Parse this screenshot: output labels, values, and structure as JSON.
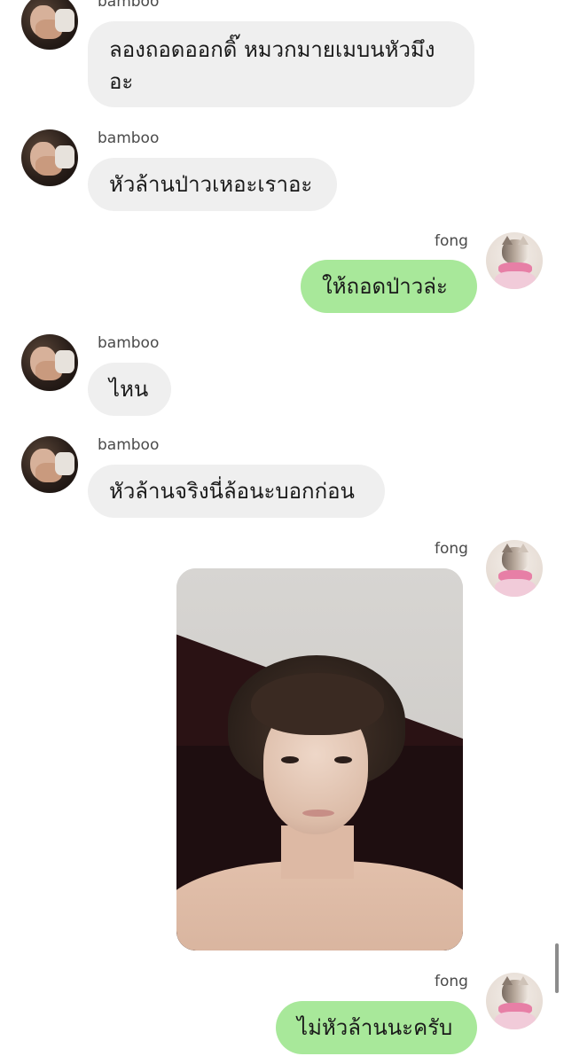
{
  "messages": [
    {
      "sender": "bamboo",
      "text_line1": "ลองถอดออกดิ๊ หมวกมายเมบนหัวมึง",
      "text_line2": "อะ"
    },
    {
      "sender": "bamboo",
      "text": "หัวล้านป่าวเหอะเราอะ"
    },
    {
      "sender": "fong",
      "text": "ให้ถอดป่าวล่ะ"
    },
    {
      "sender": "bamboo",
      "text": "ไหน"
    },
    {
      "sender": "bamboo",
      "text": "หัวล้านจริงนี่ล้อนะบอกก่อน"
    },
    {
      "sender": "fong",
      "photo": "selfie-photo"
    },
    {
      "sender": "fong",
      "text": "ไม่หัวล้านนะครับ"
    }
  ],
  "colors": {
    "incoming_bubble": "#efefef",
    "outgoing_bubble": "#a8e89a",
    "sender_name": "#4a4a4a"
  }
}
